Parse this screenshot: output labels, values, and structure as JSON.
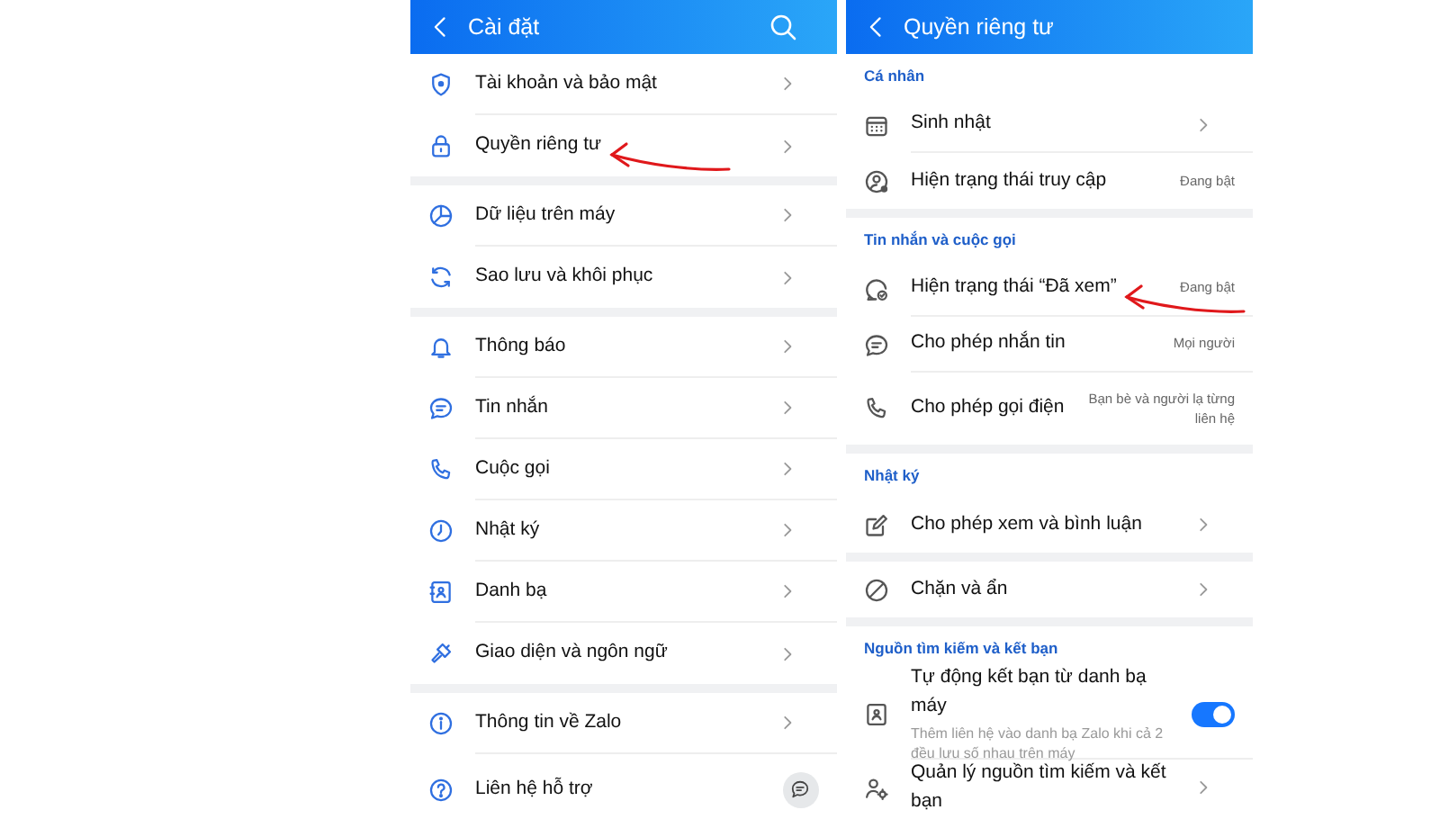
{
  "settings_panel": {
    "title": "Cài đặt",
    "groups": [
      {
        "items": [
          {
            "label": "Tài khoản và bảo mật",
            "kind": "link",
            "marked": false
          },
          {
            "label": "Quyền riêng tư",
            "kind": "link",
            "marked": true
          }
        ]
      },
      {
        "items": [
          {
            "label": "Dữ liệu trên máy",
            "kind": "link",
            "marked": false
          },
          {
            "label": "Sao lưu và khôi phục",
            "kind": "link",
            "marked": false
          }
        ]
      },
      {
        "items": [
          {
            "label": "Thông báo",
            "kind": "link",
            "marked": false
          },
          {
            "label": "Tin nhắn",
            "kind": "link",
            "marked": false
          },
          {
            "label": "Cuộc gọi",
            "kind": "link",
            "marked": false
          },
          {
            "label": "Nhật ký",
            "kind": "link",
            "marked": false
          },
          {
            "label": "Danh bạ",
            "kind": "link",
            "marked": false
          },
          {
            "label": "Giao diện và ngôn ngữ",
            "kind": "link",
            "marked": false
          }
        ]
      },
      {
        "items": [
          {
            "label": "Thông tin về Zalo",
            "kind": "link",
            "marked": false
          },
          {
            "label": "Liên hệ hỗ trợ",
            "kind": "support",
            "marked": false
          }
        ]
      }
    ]
  },
  "privacy_panel": {
    "title": "Quyền riêng tư",
    "groups": [
      {
        "heading": "Cá nhân",
        "items": [
          {
            "label": "Sinh nhật",
            "kind": "link",
            "marked": false
          },
          {
            "label": "Hiện trạng thái truy cập",
            "kind": "value",
            "value": "Đang bật",
            "marked": false
          }
        ]
      },
      {
        "heading": "Tin nhắn và cuộc gọi",
        "items": [
          {
            "label": "Hiện trạng thái “Đã xem”",
            "kind": "value",
            "value": "Đang bật",
            "marked": true
          },
          {
            "label": "Cho phép nhắn tin",
            "kind": "value",
            "value": "Mọi người",
            "marked": false
          },
          {
            "label": "Cho phép gọi điện",
            "kind": "value",
            "value": "Bạn bè và người lạ từng liên hệ",
            "marked": false
          }
        ]
      },
      {
        "heading": "Nhật ký",
        "items": [
          {
            "label": "Cho phép xem và bình luận",
            "kind": "link",
            "marked": false
          }
        ]
      },
      {
        "items": [
          {
            "label": "Chặn và ẩn",
            "kind": "link",
            "marked": false
          }
        ]
      },
      {
        "heading": "Nguồn tìm kiếm và kết bạn",
        "items": [
          {
            "label": "Tự động kết bạn từ danh bạ máy",
            "kind": "toggle",
            "description": "Thêm liên hệ vào danh bạ Zalo khi cả 2 đều lưu số nhau trên máy",
            "on": true,
            "marked": false
          },
          {
            "label": "Quản lý nguồn tìm kiếm và kết bạn",
            "kind": "link",
            "marked": false
          }
        ]
      }
    ]
  }
}
